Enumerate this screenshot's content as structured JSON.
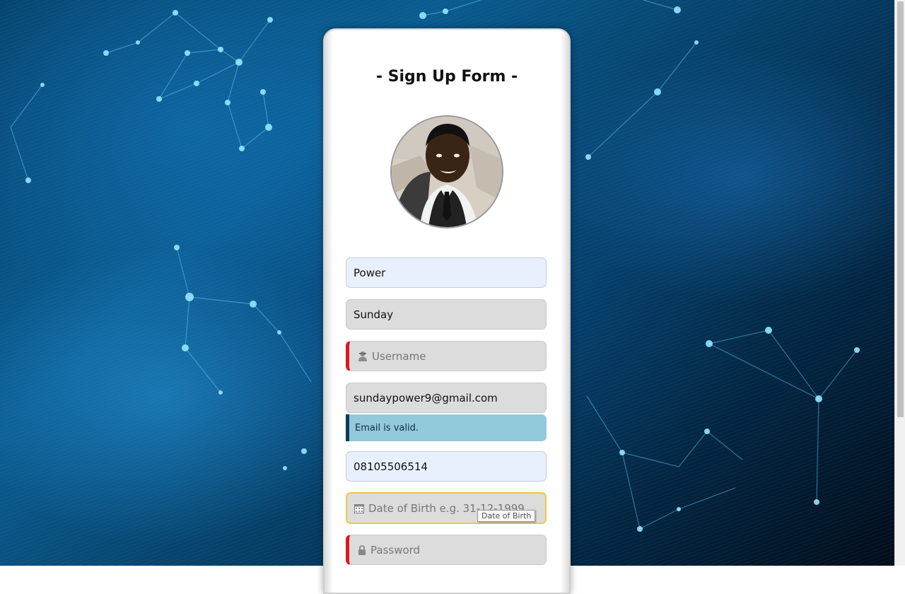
{
  "form": {
    "title": "- Sign Up Form -",
    "fields": {
      "first_name": {
        "value": "Power"
      },
      "last_name": {
        "value": "Sunday"
      },
      "username": {
        "placeholder": "Username",
        "icon": "user-icon"
      },
      "email": {
        "value": "sundaypower9@gmail.com"
      },
      "phone": {
        "value": "08105506514"
      },
      "dob": {
        "placeholder": "Date of Birth e.g. 31-12-1999",
        "icon": "calendar-icon",
        "tooltip": "Date of Birth"
      },
      "password": {
        "placeholder": "Password",
        "icon": "lock-icon"
      }
    },
    "email_status": "Email is valid."
  },
  "colors": {
    "error_border": "#e0161e",
    "valid_alert_bg": "#92c9db",
    "valid_alert_border": "#0d3b57",
    "focus_border": "#f6c34a",
    "autofill_bg": "#e8f0fe"
  }
}
